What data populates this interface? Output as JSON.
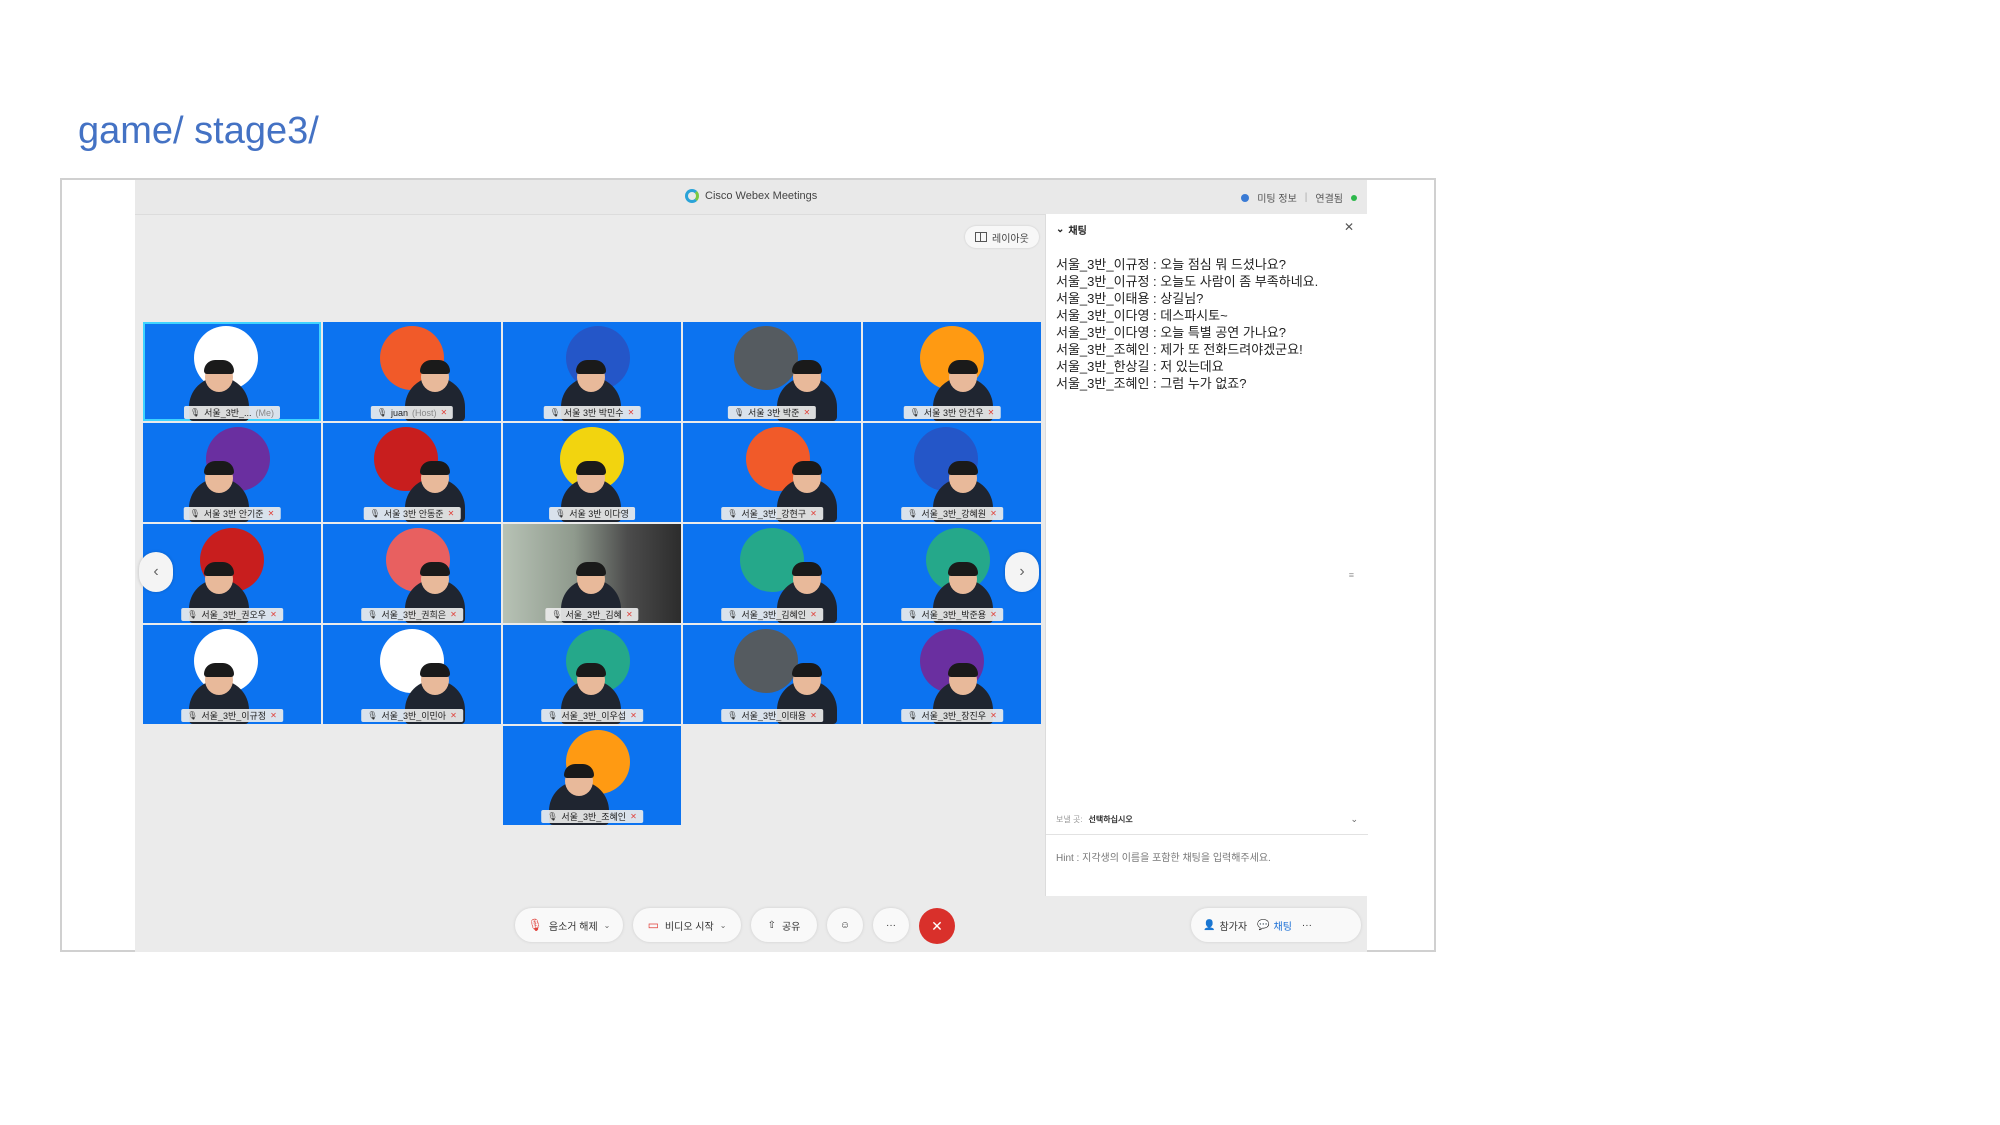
{
  "slide": {
    "title": "game/ stage3/"
  },
  "window": {
    "title": "Cisco Webex Meetings",
    "meeting_info": "미팅 정보",
    "connected": "연결됨"
  },
  "layout_button": "레이아웃",
  "participants": [
    {
      "name": "서울_3반_...",
      "suffix": "(Me)",
      "circle": "#ffffff",
      "muted": false
    },
    {
      "name": "juan",
      "suffix": "(Host)",
      "circle": "#f15a29",
      "muted": true
    },
    {
      "name": "서울 3반 박민수",
      "circle": "#2456c8",
      "muted": true
    },
    {
      "name": "서울 3반 박준",
      "circle": "#555b60",
      "muted": true
    },
    {
      "name": "서울 3반 안건우",
      "circle": "#ff9a12",
      "muted": true
    },
    {
      "name": "서울 3반 안기준",
      "circle": "#6a2fa0",
      "muted": true
    },
    {
      "name": "서울 3반 안동준",
      "circle": "#c81e1e",
      "muted": true
    },
    {
      "name": "서울 3반 이다영",
      "circle": "#f2d40f",
      "muted": false
    },
    {
      "name": "서울_3반_강현구",
      "circle": "#f15a29",
      "muted": true
    },
    {
      "name": "서울_3반_강혜원",
      "circle": "#2456c8",
      "muted": true
    },
    {
      "name": "서울_3반_권오우",
      "circle": "#c81e1e",
      "muted": true
    },
    {
      "name": "서울_3반_권희은",
      "circle": "#e86060",
      "muted": true
    },
    {
      "name": "서울_3반_김혜",
      "circle": "",
      "muted": true
    },
    {
      "name": "서울_3반_김혜인",
      "circle": "#25a88a",
      "muted": true
    },
    {
      "name": "서울_3반_박준용",
      "circle": "#25a88a",
      "muted": true
    },
    {
      "name": "서울_3반_이규정",
      "circle": "#ffffff",
      "muted": true
    },
    {
      "name": "서울_3반_이민아",
      "circle": "#ffffff",
      "muted": true
    },
    {
      "name": "서울_3반_이우섭",
      "circle": "#25a88a",
      "muted": true
    },
    {
      "name": "서울_3반_이태용",
      "circle": "#555b60",
      "muted": true
    },
    {
      "name": "서울_3반_장진우",
      "circle": "#6a2fa0",
      "muted": true
    },
    {
      "name": "서울_3반_조혜인",
      "circle": "#ff9a12",
      "muted": true
    }
  ],
  "chat": {
    "header": "채팅",
    "messages": [
      "서울_3반_이규정 : 오늘 점심 뭐 드셨나요?",
      "서울_3반_이규정 : 오늘도 사람이 좀 부족하네요.",
      "서울_3반_이태용 : 상길님?",
      "서울_3반_이다영 : 데스파시토~",
      "서울_3반_이다영 : 오늘 특별 공연 가나요?",
      "서울_3반_조혜인 : 제가 또 전화드려야겠군요!",
      "서울_3반_한상길 : 저 있는데요",
      "서울_3반_조혜인 : 그럼 누가 없죠?"
    ],
    "recipient_label": "보낼 곳:",
    "recipient_value": "선택하십시오",
    "input_placeholder": "Hint : 지각생의 이름을 포함한 채팅을 입력해주세요."
  },
  "toolbar": {
    "mute": "음소거 해제",
    "video": "비디오 시작",
    "share": "공유",
    "participants": "참가자",
    "chat": "채팅",
    "more": "···"
  },
  "colors": {
    "tile_bg": "#0c73f0",
    "end_call": "#d9302b",
    "title": "#4472c4"
  }
}
